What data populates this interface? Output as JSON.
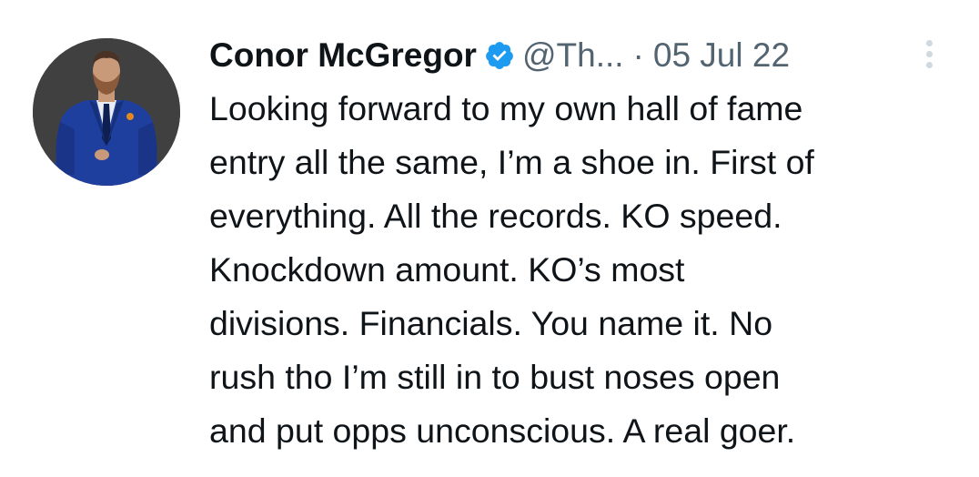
{
  "tweet": {
    "author": {
      "name": "Conor McGregor",
      "handle": "@Th...",
      "verified": true
    },
    "separator": "·",
    "date": "05 Jul 22",
    "text_lines": [
      "Looking forward to my own hall of fame",
      "entry all the same, I’m a shoe in. First of",
      "everything. All the records. KO speed.",
      "Knockdown amount. KO’s most",
      "divisions. Financials. You name it. No",
      "rush tho I’m still in to bust noses open",
      "and put opps unconscious. A real goer."
    ]
  },
  "icons": {
    "verified": "verified-badge-icon",
    "more": "more-vertical-icon"
  },
  "colors": {
    "verified_blue": "#1d9bf0",
    "text": "#0f1419",
    "secondary_text": "#536471",
    "more_dots": "#cfd9de"
  }
}
